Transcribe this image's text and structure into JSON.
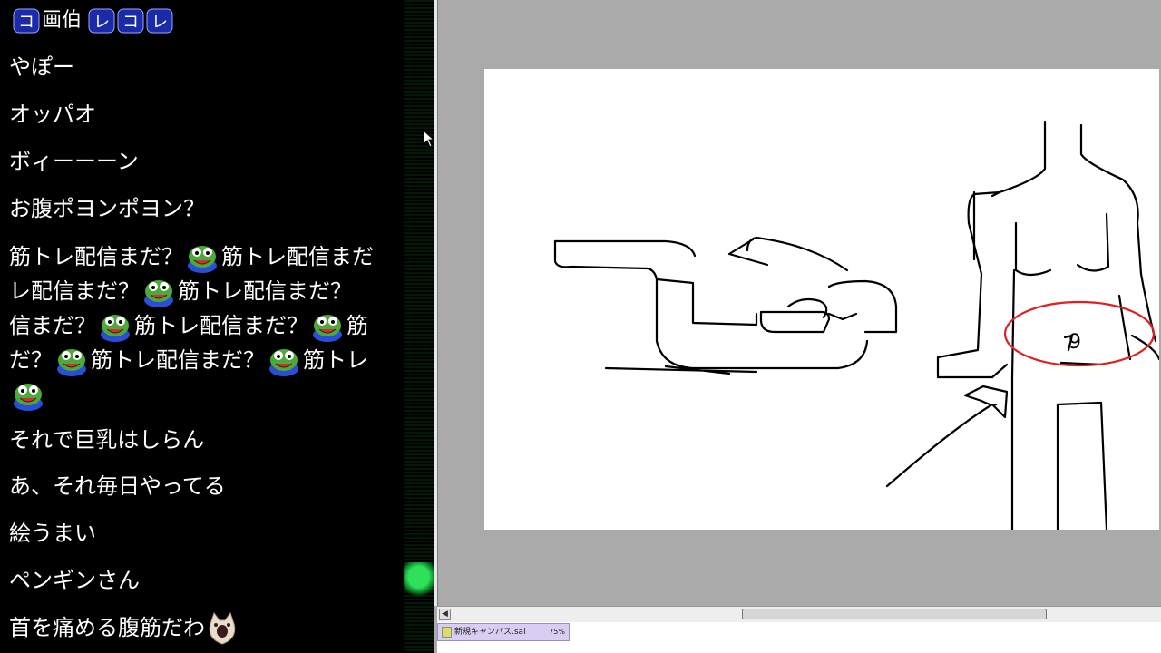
{
  "chat": {
    "top_line": {
      "prefix_badge": "コ",
      "text1": "画伯",
      "badges": [
        "レ",
        "コ",
        "レ"
      ]
    },
    "messages": [
      "やぽー",
      "オッパオ",
      "ボィーーーン",
      "お腹ポヨンポヨン？"
    ],
    "spam_lines": [
      "筋トレ配信まだ？",
      "筋トレ配信まだ？",
      "筋トレ配信まだ？",
      "筋トレ配信まだ？"
    ],
    "spam_rows": [
      [
        "筋トレ配信まだ？",
        "筋トレ配信まだ"
      ],
      [
        "レ配信まだ？",
        "筋トレ配信まだ？"
      ],
      [
        "信まだ？",
        "筋トレ配信まだ？",
        "筋"
      ],
      [
        "だ？",
        "筋トレ配信まだ？",
        "筋トレ"
      ]
    ],
    "later_messages": [
      "それで巨乳はしらん",
      "あ、それ毎日やってる",
      "絵うまい",
      "ペンギンさん",
      "首を痛める腹筋だわ"
    ],
    "emotes": [
      "pepe-emote",
      "cat-emote"
    ]
  },
  "app": {
    "document_tab": {
      "name": "新規キャンバス.sai",
      "zoom": "75%"
    },
    "canvas_annotation": "9",
    "colors": {
      "workspace": "#aaaaaa",
      "canvas": "#ffffff",
      "circle": "#e02020",
      "tab": "#d9cdf2"
    }
  },
  "icons": [
    "mouse-cursor-icon",
    "scroll-left-arrow-icon",
    "document-icon"
  ]
}
